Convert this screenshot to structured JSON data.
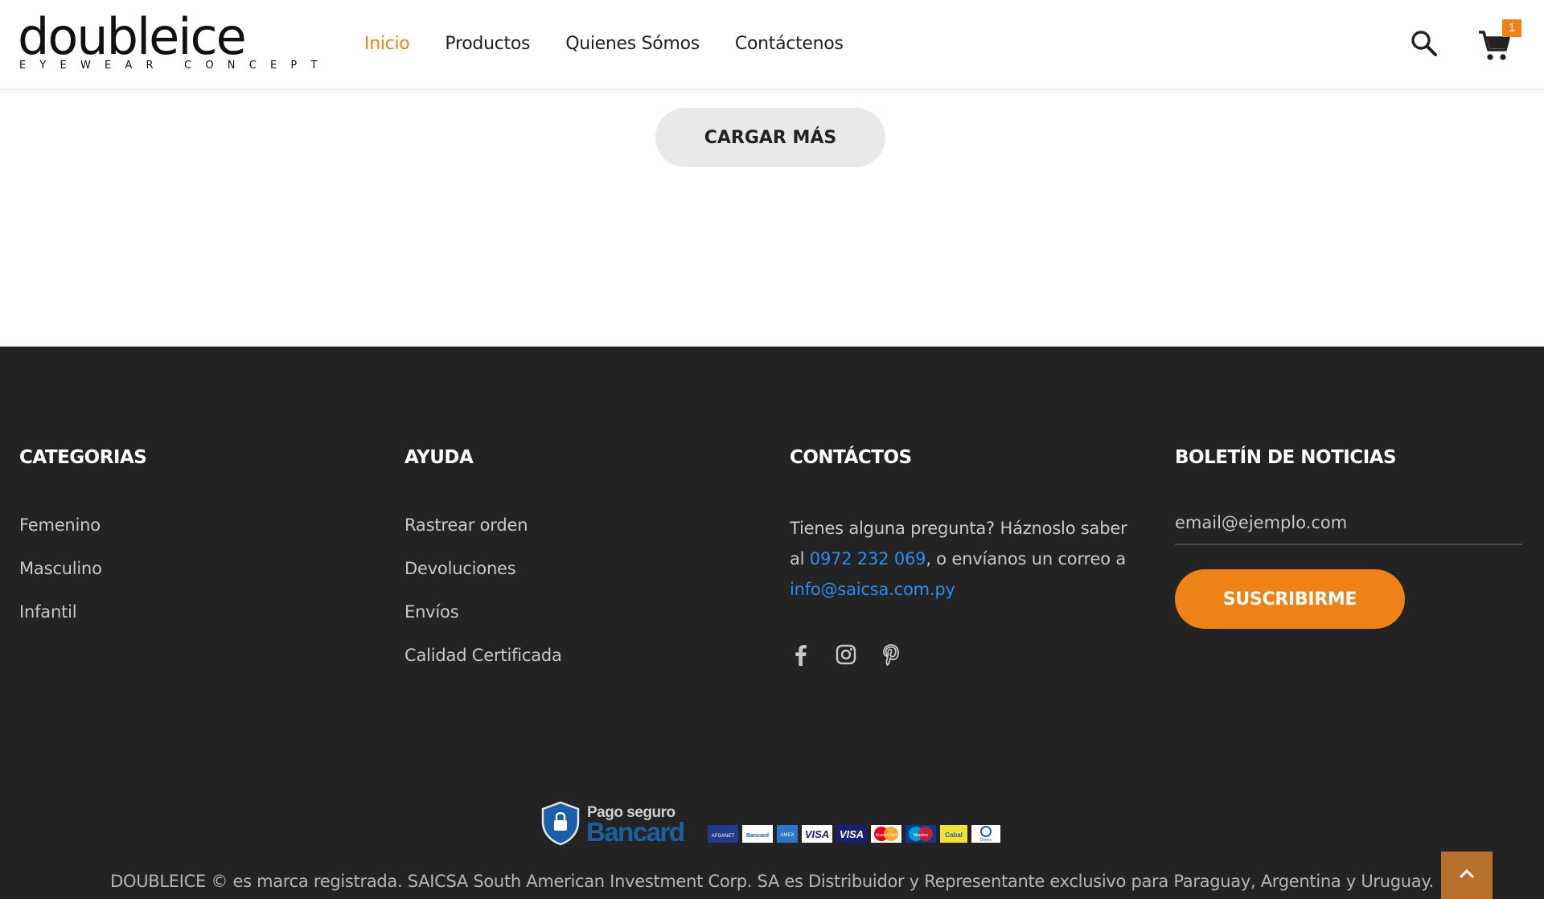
{
  "header": {
    "logo_main": "doubleice",
    "logo_sub": "EYEWEAR CONCEPT",
    "nav": [
      {
        "label": "Inicio",
        "active": true
      },
      {
        "label": "Productos",
        "active": false
      },
      {
        "label": "Quienes Sómos",
        "active": false
      },
      {
        "label": "Contáctenos",
        "active": false
      }
    ],
    "search_icon": "search-icon",
    "cart_icon": "cart-icon",
    "cart_count": "1"
  },
  "main": {
    "load_more_label": "CARGAR MÁS"
  },
  "footer": {
    "categories": {
      "title": "CATEGORIAS",
      "items": [
        "Femenino",
        "Masculino",
        "Infantil"
      ]
    },
    "help": {
      "title": "AYUDA",
      "items": [
        "Rastrear orden",
        "Devoluciones",
        "Envíos",
        "Calidad Certificada"
      ]
    },
    "contacts": {
      "title": "CONTÁCTOS",
      "text_before": "Tienes alguna pregunta? Háznoslo saber al ",
      "phone": "0972 232 069",
      "text_middle": ", o envíanos un correo a ",
      "email": "info@saicsa.com.py",
      "socials": [
        "facebook-icon",
        "instagram-icon",
        "pinterest-icon"
      ]
    },
    "newsletter": {
      "title": "BOLETÍN DE NOTICIAS",
      "placeholder": "email@ejemplo.com",
      "button_label": "SUSCRIBIRME"
    },
    "payment": {
      "top_label": "Pago seguro",
      "brand": "Bancard",
      "cards": [
        "AFGANET",
        "Bancard",
        "AMEX",
        "VISA",
        "VISA",
        "MasterCard",
        "Maestro",
        "Cabal",
        "Diners"
      ]
    },
    "copyright": "DOUBLEICE © es marca registrada. SAICSA South American Investment Corp. SA es Distribuidor y Representante exclusivo para Paraguay, Argentina y Uruguay."
  },
  "colors": {
    "accent": "#ee8216",
    "footer_bg": "#232323",
    "link": "#2d8cf0",
    "scroll_top_bg": "#b8702c"
  }
}
